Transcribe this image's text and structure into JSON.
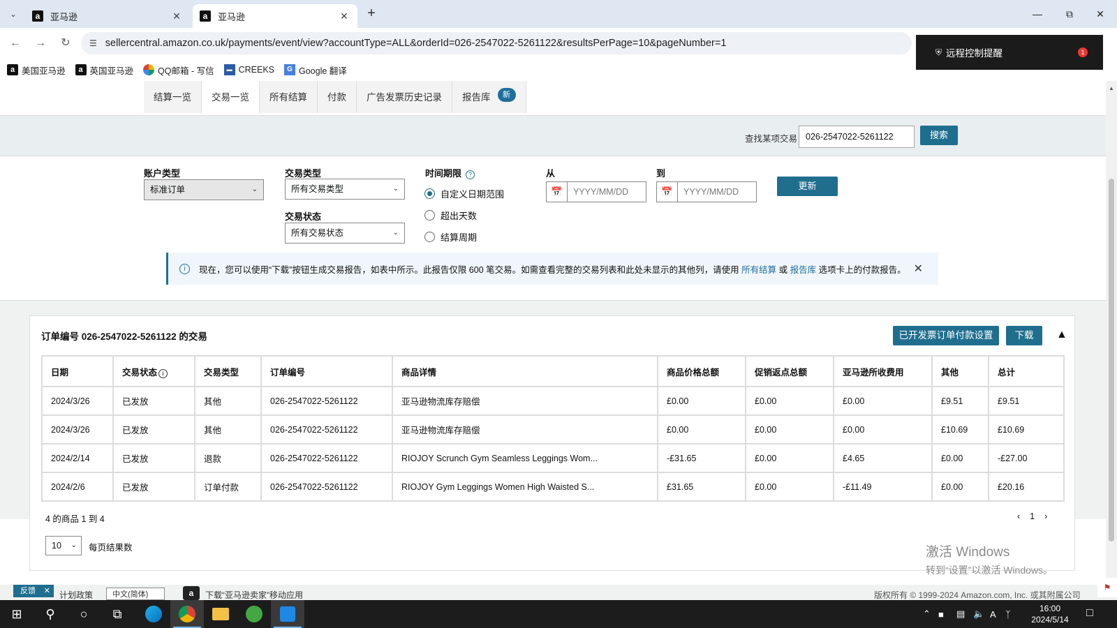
{
  "browser": {
    "tabs": [
      {
        "title": "亚马逊",
        "active": false
      },
      {
        "title": "亚马逊",
        "active": true
      }
    ],
    "url": "sellercentral.amazon.co.uk/payments/event/view?accountType=ALL&orderId=026-2547022-5261122&resultsPerPage=10&pageNumber=1",
    "bookmarks": [
      {
        "label": "美国亚马逊",
        "icon": "amazon-icon"
      },
      {
        "label": "英国亚马逊",
        "icon": "amazon-icon"
      },
      {
        "label": "QQ邮箱 - 写信",
        "icon": "qq-mail-icon"
      },
      {
        "label": "CREEKS",
        "icon": "creeks-icon"
      },
      {
        "label": "Google 翻译",
        "icon": "google-translate-icon"
      }
    ],
    "remote_popup": {
      "text": "远程控制提醒",
      "badge": "1"
    }
  },
  "subnav": {
    "items": [
      {
        "label": "结算一览"
      },
      {
        "label": "交易一览"
      },
      {
        "label": "所有结算"
      },
      {
        "label": "付款"
      },
      {
        "label": "广告发票历史记录"
      },
      {
        "label": "报告库"
      }
    ],
    "new_badge": "新"
  },
  "search": {
    "label": "查找某项交易",
    "value": "026-2547022-5261122",
    "button": "搜索"
  },
  "filters": {
    "account_type": {
      "label": "账户类型",
      "value": "标准订单"
    },
    "transaction_type": {
      "label": "交易类型",
      "value": "所有交易类型"
    },
    "transaction_status": {
      "label": "交易状态",
      "value": "所有交易状态"
    },
    "time_period": {
      "label": "时间期限",
      "options": [
        "自定义日期范围",
        "超出天数",
        "结算周期"
      ],
      "selected": "自定义日期范围"
    },
    "from": {
      "label": "从",
      "placeholder": "YYYY/MM/DD"
    },
    "to": {
      "label": "到",
      "placeholder": "YYYY/MM/DD"
    },
    "update_button": "更新"
  },
  "info_banner": {
    "text_before": "现在，您可以使用“下载”按钮生成交易报告，如表中所示。此报告仅限 600 笔交易。如需查看完整的交易列表和此处未显示的其他列，请使用 ",
    "link1": "所有结算",
    "middle": " 或 ",
    "link2": "报告库",
    "text_after": " 选项卡上的付款报告。"
  },
  "panel": {
    "title": "订单编号 026-2547022-5261122 的交易",
    "invoice_settings_button": "已开发票订单付款设置",
    "download_button": "下载",
    "columns": [
      "日期",
      "交易状态",
      "交易类型",
      "订单编号",
      "商品详情",
      "商品价格总额",
      "促销返点总额",
      "亚马逊所收费用",
      "其他",
      "总计"
    ],
    "rows": [
      {
        "date": "2024/3/26",
        "status": "已发放",
        "type": "其他",
        "order": "026-2547022-5261122",
        "details": "亚马逊物流库存赔偿",
        "price": "£0.00",
        "promo": "£0.00",
        "fees": "£0.00",
        "other": "£9.51",
        "total": "£9.51"
      },
      {
        "date": "2024/3/26",
        "status": "已发放",
        "type": "其他",
        "order": "026-2547022-5261122",
        "details": "亚马逊物流库存赔偿",
        "price": "£0.00",
        "promo": "£0.00",
        "fees": "£0.00",
        "other": "£10.69",
        "total": "£10.69"
      },
      {
        "date": "2024/2/14",
        "status": "已发放",
        "type": "退款",
        "order": "026-2547022-5261122",
        "details": "RIOJOY Scrunch Gym Seamless Leggings Wom...",
        "price": "-£31.65",
        "promo": "£0.00",
        "fees": "£4.65",
        "other": "£0.00",
        "total": "-£27.00"
      },
      {
        "date": "2024/2/6",
        "status": "已发放",
        "type": "订单付款",
        "order": "026-2547022-5261122",
        "details": "RIOJOY Gym Leggings Women High Waisted S...",
        "price": "£31.65",
        "promo": "£0.00",
        "fees": "-£11.49",
        "other": "£0.00",
        "total": "£20.16"
      }
    ],
    "range_text": "4 的商品 1 到 4",
    "current_page": "1",
    "per_page_value": "10",
    "per_page_label": "每页结果数"
  },
  "watermark": {
    "line1": "激活 Windows",
    "line2": "转到“设置”以激活 Windows。"
  },
  "footer": {
    "feedback": "反馈",
    "policy": "计划政策",
    "language": "中文(简体)",
    "download_app": "下载“亚马逊卖家”移动应用",
    "copyright": "版权所有 © 1999-2024 Amazon.com, Inc. 或其附属公司"
  },
  "taskbar": {
    "time": "16:00",
    "date": "2024/5/14",
    "ime": "A"
  },
  "colors": {
    "accent": "#1f6e8e",
    "link": "#1f6e9e",
    "negative": "#b12704"
  }
}
